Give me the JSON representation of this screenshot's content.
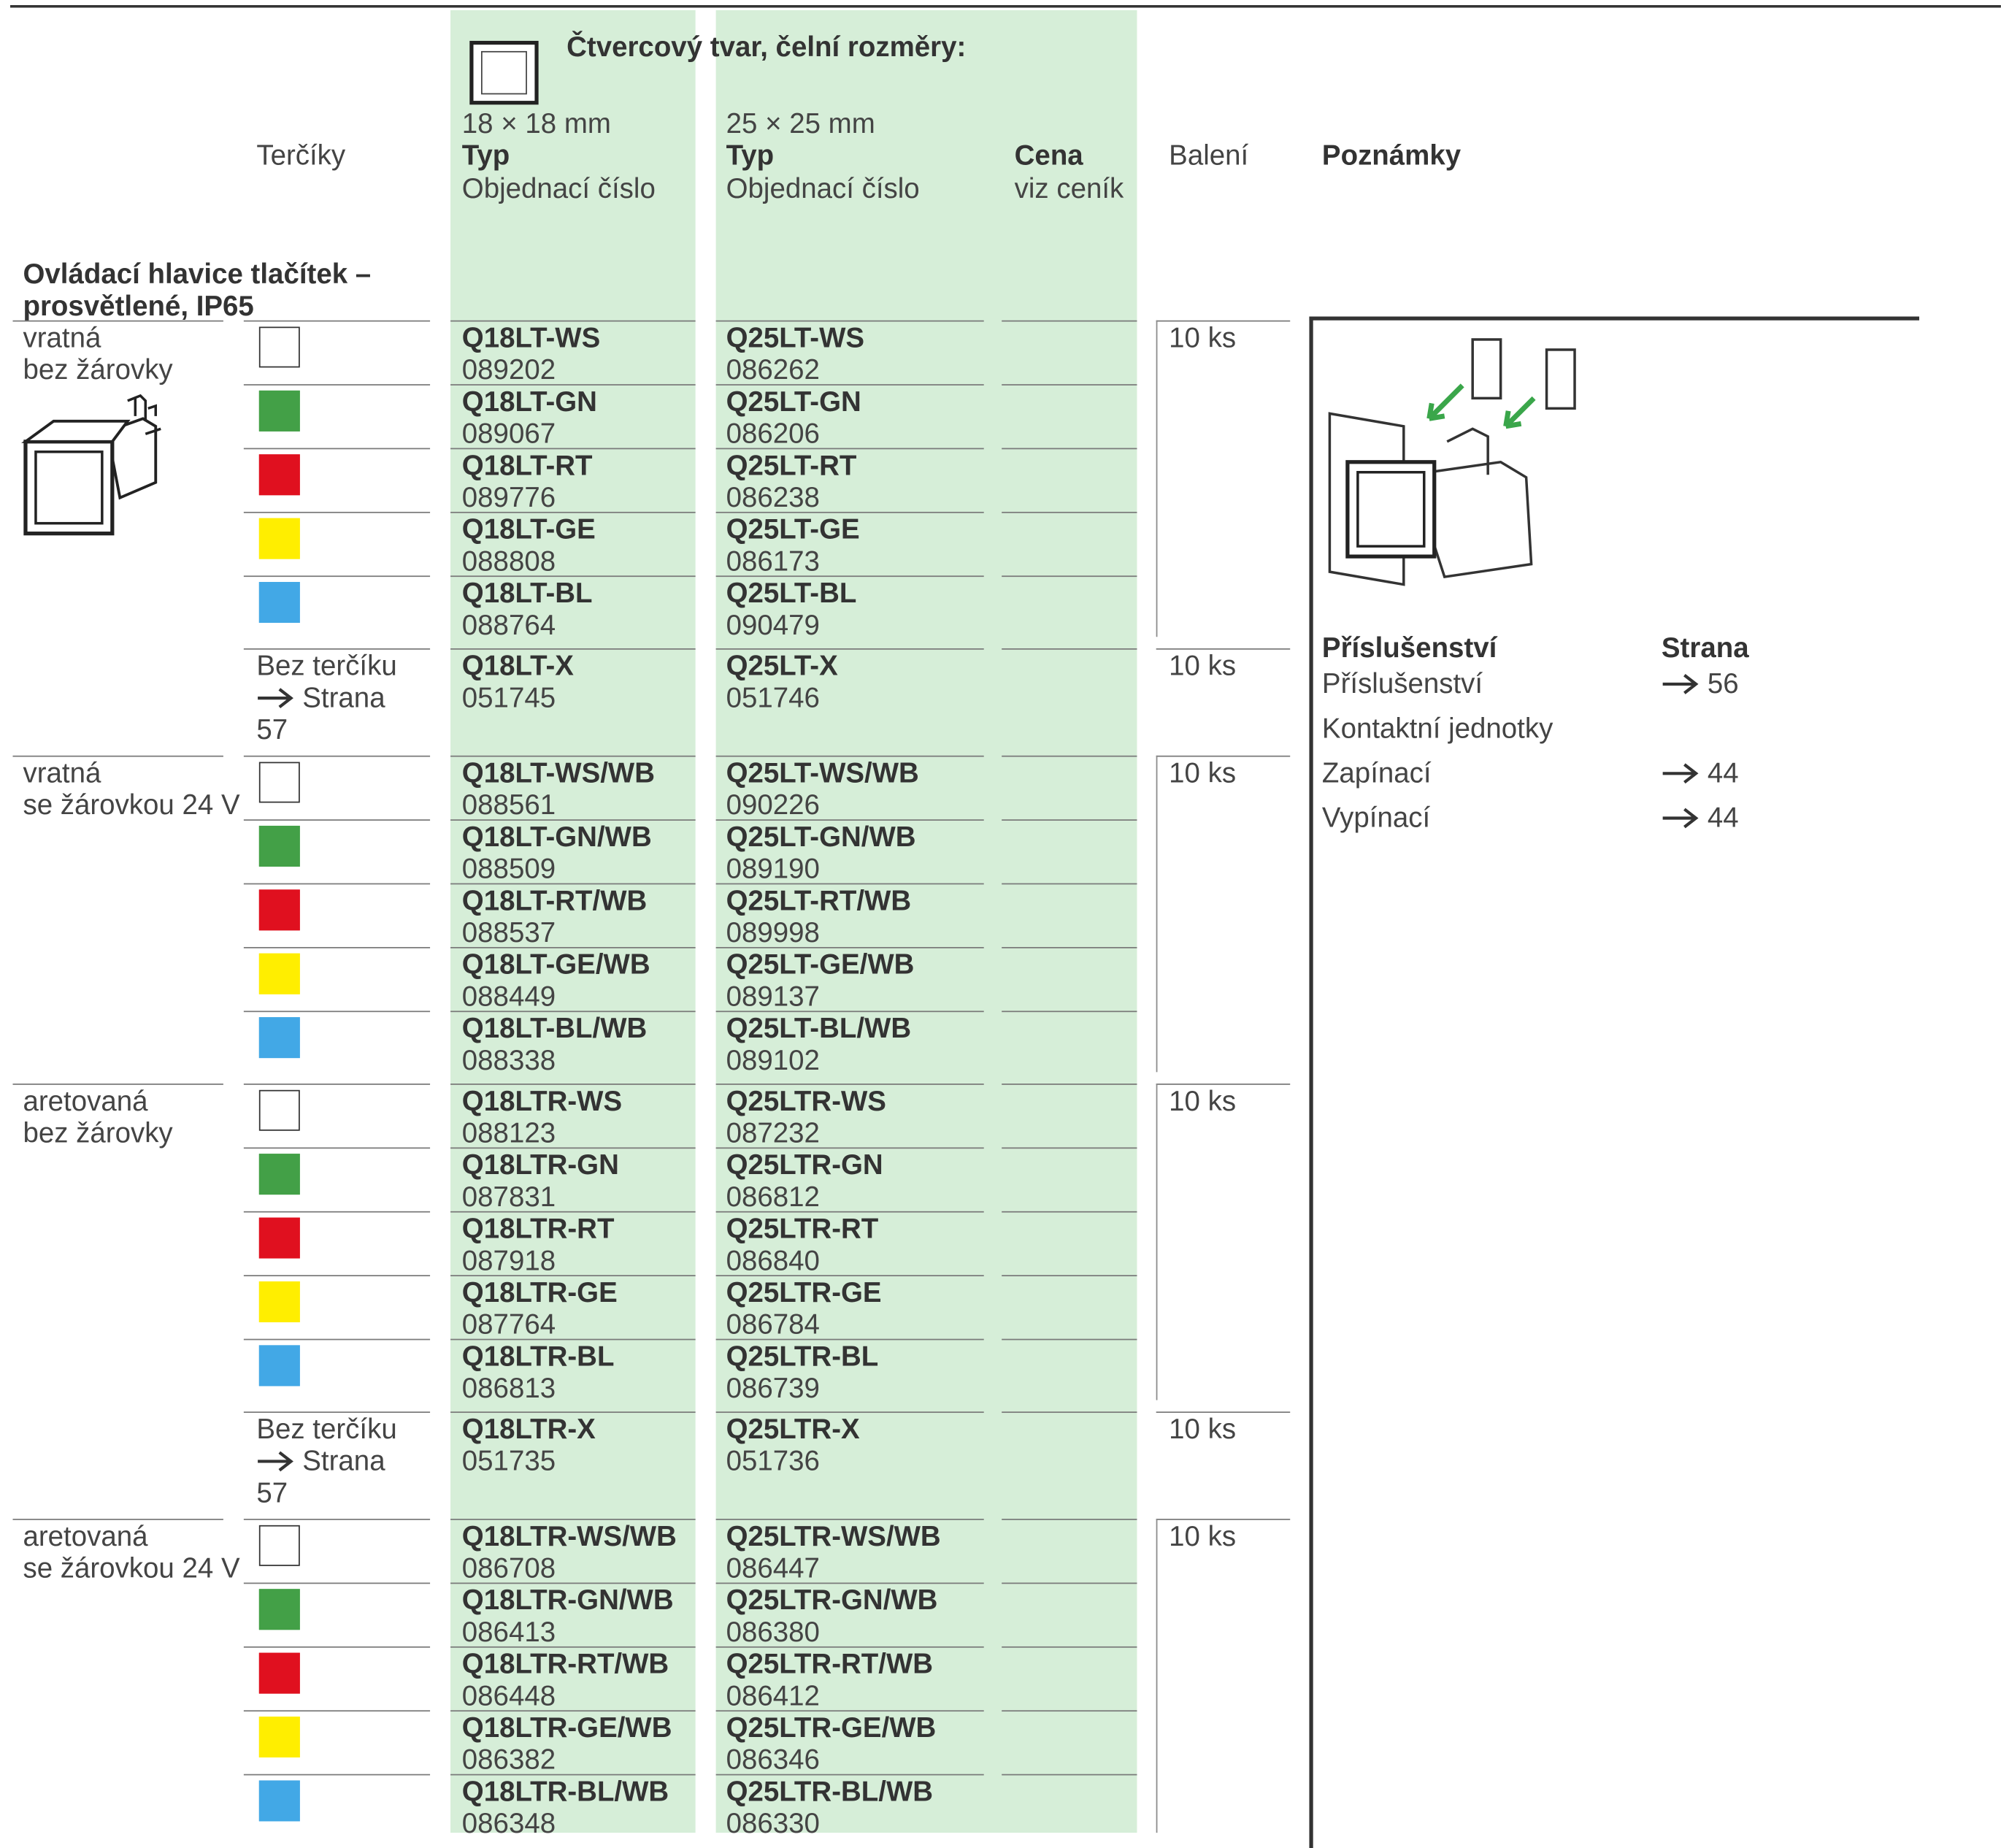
{
  "header": {
    "shape_title": "Čtvercový tvar, čelní rozměry:",
    "size_18": "18 × 18 mm",
    "size_25": "25 × 25 mm",
    "typ": "Typ",
    "order_no": "Objednací číslo",
    "targets": "Terčíky",
    "price": "Cena",
    "price_sub": "viz ceník",
    "packing": "Balení",
    "notes": "Poznámky"
  },
  "section_title_1": "Ovládací hlavice tlačítek –",
  "section_title_2": "prosvětlené, IP65",
  "colors": {
    "white": "#ffffff",
    "green": "#43a047",
    "red": "#e0101f",
    "yellow": "#ffee00",
    "blue": "#42a8e6",
    "band": "#d6eed8"
  },
  "groups": [
    {
      "label1": "vratná",
      "label2": "bez žárovky",
      "pack": "10 ks"
    },
    {
      "label1": "vratná",
      "label2": "se žárovkou 24 V",
      "pack": "10 ks"
    },
    {
      "label1": "aretovaná",
      "label2": "bez žárovky",
      "pack": "10 ks"
    },
    {
      "label1": "aretovaná",
      "label2": "se žárovkou 24 V",
      "pack": "10 ks"
    }
  ],
  "no_target": {
    "line1": "Bez terčíku",
    "line2": "Strana",
    "line3": "57",
    "pack": "10 ks"
  },
  "rows": [
    {
      "t18": "Q18LT-WS",
      "n18": "089202",
      "t25": "Q25LT-WS",
      "n25": "086262"
    },
    {
      "t18": "Q18LT-GN",
      "n18": "089067",
      "t25": "Q25LT-GN",
      "n25": "086206"
    },
    {
      "t18": "Q18LT-RT",
      "n18": "089776",
      "t25": "Q25LT-RT",
      "n25": "086238"
    },
    {
      "t18": "Q18LT-GE",
      "n18": "088808",
      "t25": "Q25LT-GE",
      "n25": "086173"
    },
    {
      "t18": "Q18LT-BL",
      "n18": "088764",
      "t25": "Q25LT-BL",
      "n25": "090479"
    },
    {
      "t18": "Q18LT-X",
      "n18": "051745",
      "t25": "Q25LT-X",
      "n25": "051746"
    },
    {
      "t18": "Q18LT-WS/WB",
      "n18": "088561",
      "t25": "Q25LT-WS/WB",
      "n25": "090226"
    },
    {
      "t18": "Q18LT-GN/WB",
      "n18": "088509",
      "t25": "Q25LT-GN/WB",
      "n25": "089190"
    },
    {
      "t18": "Q18LT-RT/WB",
      "n18": "088537",
      "t25": "Q25LT-RT/WB",
      "n25": "089998"
    },
    {
      "t18": "Q18LT-GE/WB",
      "n18": "088449",
      "t25": "Q25LT-GE/WB",
      "n25": "089137"
    },
    {
      "t18": "Q18LT-BL/WB",
      "n18": "088338",
      "t25": "Q25LT-BL/WB",
      "n25": "089102"
    },
    {
      "t18": "Q18LTR-WS",
      "n18": "088123",
      "t25": "Q25LTR-WS",
      "n25": "087232"
    },
    {
      "t18": "Q18LTR-GN",
      "n18": "087831",
      "t25": "Q25LTR-GN",
      "n25": "086812"
    },
    {
      "t18": "Q18LTR-RT",
      "n18": "087918",
      "t25": "Q25LTR-RT",
      "n25": "086840"
    },
    {
      "t18": "Q18LTR-GE",
      "n18": "087764",
      "t25": "Q25LTR-GE",
      "n25": "086784"
    },
    {
      "t18": "Q18LTR-BL",
      "n18": "086813",
      "t25": "Q25LTR-BL",
      "n25": "086739"
    },
    {
      "t18": "Q18LTR-X",
      "n18": "051735",
      "t25": "Q25LTR-X",
      "n25": "051736"
    },
    {
      "t18": "Q18LTR-WS/WB",
      "n18": "086708",
      "t25": "Q25LTR-WS/WB",
      "n25": "086447"
    },
    {
      "t18": "Q18LTR-GN/WB",
      "n18": "086413",
      "t25": "Q25LTR-GN/WB",
      "n25": "086380"
    },
    {
      "t18": "Q18LTR-RT/WB",
      "n18": "086448",
      "t25": "Q25LTR-RT/WB",
      "n25": "086412"
    },
    {
      "t18": "Q18LTR-GE/WB",
      "n18": "086382",
      "t25": "Q25LTR-GE/WB",
      "n25": "086346"
    },
    {
      "t18": "Q18LTR-BL/WB",
      "n18": "086348",
      "t25": "Q25LTR-BL/WB",
      "n25": "086330"
    }
  ],
  "accessories": {
    "title": "Příslušenství",
    "page_col": "Strana",
    "items": [
      {
        "label": "Příslušenství",
        "page": "56"
      },
      {
        "label": "Kontaktní jednotky",
        "page": ""
      },
      {
        "label": "Zapínací",
        "page": "44"
      },
      {
        "label": "Vypínací",
        "page": "44"
      }
    ]
  }
}
